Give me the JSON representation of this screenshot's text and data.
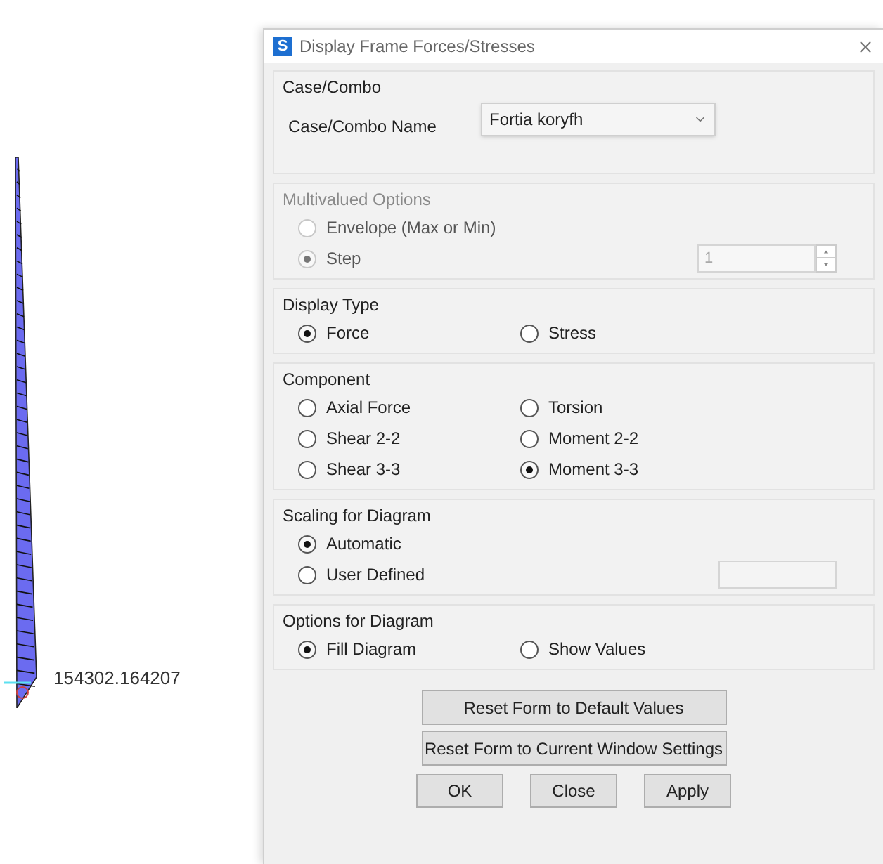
{
  "canvas": {
    "value_label": "154302.164207"
  },
  "window": {
    "icon_letter": "S",
    "title": "Display Frame Forces/Stresses"
  },
  "sections": [
    {
      "kind": "combo",
      "title": "Case/Combo",
      "label": "Case/Combo Name",
      "value": "Fortia koryfh",
      "disabled": false
    },
    {
      "kind": "stacked",
      "title": "Multivalued Options",
      "disabled": true,
      "options": [
        {
          "label": "Envelope (Max or Min)",
          "selected": false
        },
        {
          "label": "Step",
          "selected": true
        }
      ],
      "field": {
        "value": "1",
        "spinner": true
      }
    },
    {
      "kind": "paired",
      "title": "Display Type",
      "disabled": false,
      "options": [
        {
          "label": "Force",
          "selected": true
        },
        {
          "label": "Stress",
          "selected": false
        }
      ]
    },
    {
      "kind": "paired",
      "title": "Component",
      "disabled": false,
      "options": [
        {
          "label": "Axial Force",
          "selected": false
        },
        {
          "label": "Torsion",
          "selected": false
        },
        {
          "label": "Shear 2-2",
          "selected": false
        },
        {
          "label": "Moment 2-2",
          "selected": false
        },
        {
          "label": "Shear 3-3",
          "selected": false
        },
        {
          "label": "Moment 3-3",
          "selected": true
        }
      ]
    },
    {
      "kind": "stacked",
      "title": "Scaling for Diagram",
      "disabled": false,
      "options": [
        {
          "label": "Automatic",
          "selected": true
        },
        {
          "label": "User Defined",
          "selected": false
        }
      ],
      "field": {
        "spinner": false
      }
    },
    {
      "kind": "paired",
      "title": "Options for Diagram",
      "disabled": false,
      "options": [
        {
          "label": "Fill Diagram",
          "selected": true
        },
        {
          "label": "Show Values",
          "selected": false
        }
      ]
    }
  ],
  "wide_buttons": [
    "Reset Form to Default Values",
    "Reset Form to Current Window Settings"
  ],
  "buttons": [
    "OK",
    "Close",
    "Apply"
  ]
}
